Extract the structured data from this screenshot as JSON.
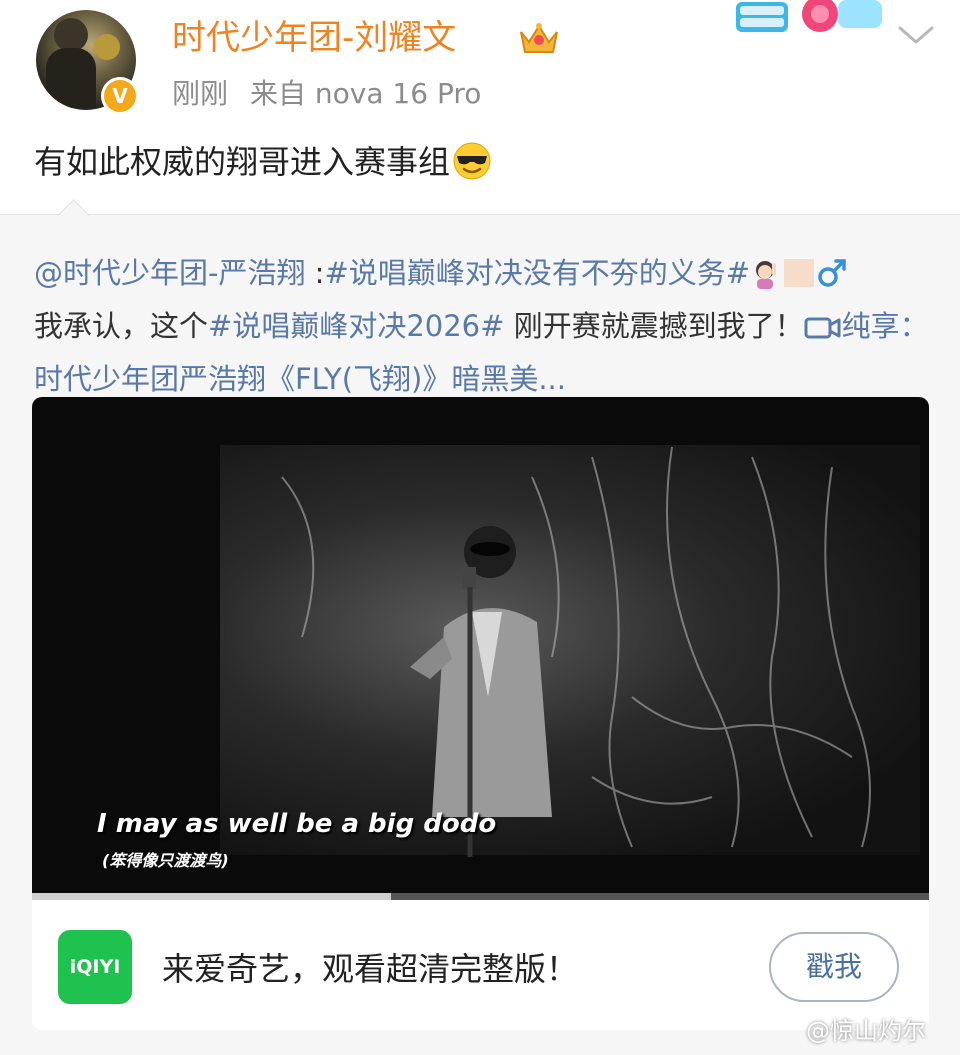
{
  "post": {
    "author": "时代少年团-刘耀文",
    "verified_mark": "V",
    "time": "刚刚",
    "source": "来自 nova 16 Pro",
    "text": "有如此权威的翔哥进入赛事组",
    "emoji": "sunglasses-emoji"
  },
  "repost": {
    "mention": "@时代少年团-严浩翔",
    "separator": " :",
    "hashtag1": "#说唱巅峰对决没有不夯的义务#",
    "text1": "我承认，这个",
    "hashtag2": "#说唱巅峰对决2026#",
    "text2": " 刚开赛就震撼到我了！",
    "video_link": "纯享：时代少年团严浩翔《FLY(飞翔)》暗黑美..."
  },
  "video": {
    "subtitle_en": "I may as well be a big dodo",
    "subtitle_zh": "(笨得像只渡渡鸟)",
    "progress": 0.4
  },
  "ad": {
    "logo_text": "iQIYI",
    "text": "来爱奇艺，观看超清完整版！",
    "button": "戳我"
  },
  "watermark": "@惊山灼尔",
  "colors": {
    "username": "#f08321",
    "link": "#5b79a6",
    "iqiyi_green": "#1fc24e"
  }
}
